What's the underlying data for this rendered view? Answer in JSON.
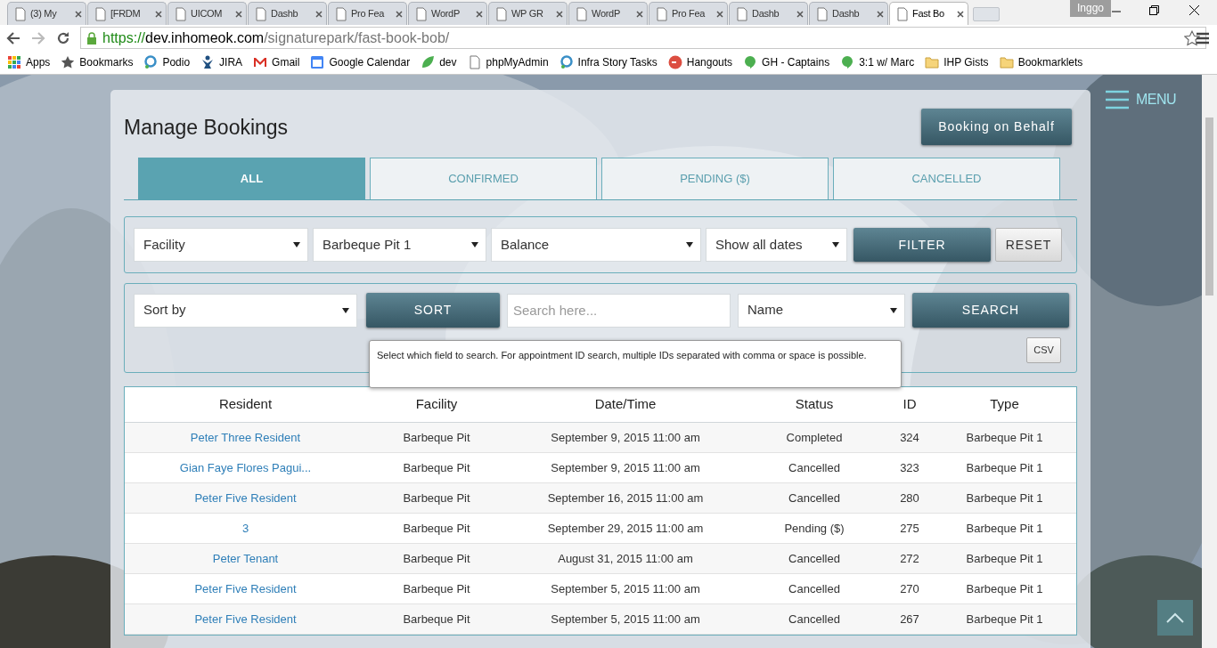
{
  "browser": {
    "tabs": [
      {
        "title": "(3) My",
        "selected": false
      },
      {
        "title": "[FRDM",
        "selected": false
      },
      {
        "title": "UICOM",
        "selected": false
      },
      {
        "title": "Dashb",
        "selected": false
      },
      {
        "title": "Pro Fea",
        "selected": false
      },
      {
        "title": "WordP",
        "selected": false
      },
      {
        "title": "WP GR",
        "selected": false
      },
      {
        "title": "WordP",
        "selected": false
      },
      {
        "title": "Pro Fea",
        "selected": false
      },
      {
        "title": "Dashb",
        "selected": false
      },
      {
        "title": "Dashb",
        "selected": false
      },
      {
        "title": "Fast Bo",
        "selected": true
      }
    ],
    "profile": "Inggo",
    "url": {
      "scheme": "https://",
      "host": "dev.inhomeok.com",
      "path": "/signaturepark/fast-book-bob/"
    },
    "bookmarks": [
      {
        "label": "Apps",
        "kind": "grid"
      },
      {
        "label": "Bookmarks",
        "kind": "star"
      },
      {
        "label": "Podio",
        "kind": "pin"
      },
      {
        "label": "JIRA",
        "kind": "figure"
      },
      {
        "label": "Gmail",
        "kind": "mail"
      },
      {
        "label": "Google Calendar",
        "kind": "calendar"
      },
      {
        "label": "dev",
        "kind": "leaf"
      },
      {
        "label": "phpMyAdmin",
        "kind": "page"
      },
      {
        "label": "Infra Story Tasks",
        "kind": "pin"
      },
      {
        "label": "Hangouts",
        "kind": "circle"
      },
      {
        "label": "GH - Captains",
        "kind": "bubble"
      },
      {
        "label": "3:1 w/ Marc",
        "kind": "bubble"
      },
      {
        "label": "IHP Gists",
        "kind": "folder"
      },
      {
        "label": "Bookmarklets",
        "kind": "folder"
      }
    ]
  },
  "menu": "MENU",
  "title": "Manage Bookings",
  "behalf_button": "Booking on Behalf",
  "tabs": [
    {
      "label": "ALL",
      "selected": true
    },
    {
      "label": "CONFIRMED",
      "selected": false
    },
    {
      "label": "PENDING ($)",
      "selected": false
    },
    {
      "label": "CANCELLED",
      "selected": false
    }
  ],
  "filters": {
    "selects": [
      "Facility",
      "Barbeque Pit 1",
      "Balance",
      "Show all dates"
    ],
    "filter_button": "FILTER",
    "reset_button": "RESET"
  },
  "search": {
    "sort_select": "Sort by",
    "sort_button": "SORT",
    "placeholder": "Search here...",
    "field_select": "Name",
    "search_button": "SEARCH",
    "tooltip": "Select which field to search. For appointment ID search, multiple IDs separated with comma or space is possible.",
    "csv_button": "CSV"
  },
  "table": {
    "columns": [
      "Resident",
      "Facility",
      "Date/Time",
      "Status",
      "ID",
      "Type"
    ],
    "rows": [
      [
        "Peter Three Resident",
        "Barbeque Pit",
        "September 9, 2015 11:00 am",
        "Completed",
        "324",
        "Barbeque Pit 1"
      ],
      [
        "Gian Faye Flores Pagui...",
        "Barbeque Pit",
        "September 9, 2015 11:00 am",
        "Cancelled",
        "323",
        "Barbeque Pit 1"
      ],
      [
        "Peter Five Resident",
        "Barbeque Pit",
        "September 16, 2015 11:00 am",
        "Cancelled",
        "280",
        "Barbeque Pit 1"
      ],
      [
        "3",
        "Barbeque Pit",
        "September 29, 2015 11:00 am",
        "Pending ($)",
        "275",
        "Barbeque Pit 1"
      ],
      [
        "Peter Tenant",
        "Barbeque Pit",
        "August 31, 2015 11:00 am",
        "Cancelled",
        "272",
        "Barbeque Pit 1"
      ],
      [
        "Peter Five Resident",
        "Barbeque Pit",
        "September 5, 2015 11:00 am",
        "Cancelled",
        "270",
        "Barbeque Pit 1"
      ],
      [
        "Peter Five Resident",
        "Barbeque Pit",
        "September 5, 2015 11:00 am",
        "Cancelled",
        "267",
        "Barbeque Pit 1"
      ]
    ]
  }
}
